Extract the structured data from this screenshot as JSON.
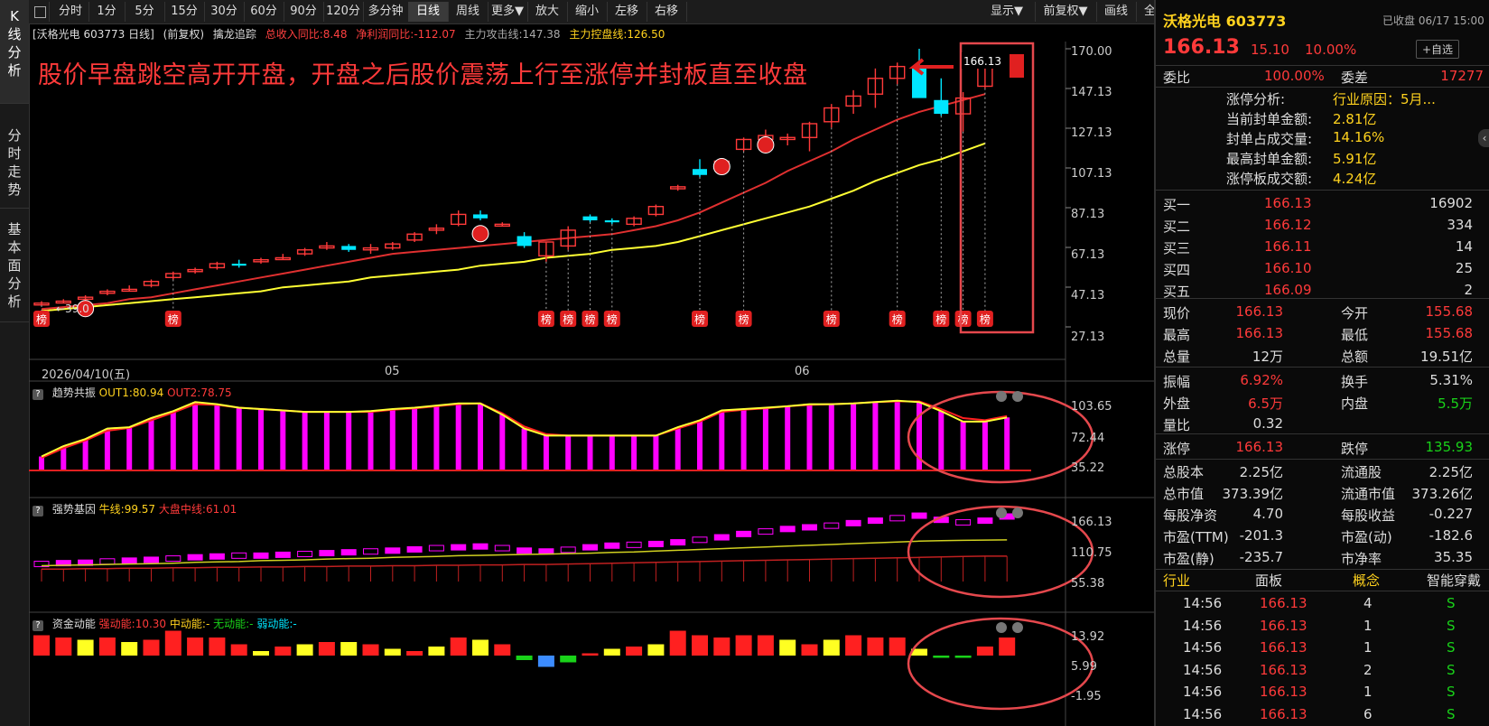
{
  "left_rail": [
    {
      "label": "K线分析"
    },
    {
      "label": "分时走势"
    },
    {
      "label": "基本面分析"
    }
  ],
  "toolbar": {
    "items": [
      "分时",
      "1分",
      "5分",
      "15分",
      "30分",
      "60分",
      "90分",
      "120分",
      "多分钟",
      "日线",
      "周线",
      "更多▼",
      "放大",
      "缩小",
      "左移",
      "右移"
    ],
    "active": "日线",
    "right_items": [
      "显示▼",
      "前复权▼",
      "画线",
      "全屏"
    ]
  },
  "chart_info": {
    "name": "[沃格光电 603773 日线]",
    "adj": "(前复权)",
    "indicator": "擒龙追踪",
    "rev": "总收入同比:8.48",
    "profit": "净利润同比:-112.07",
    "attack": "主力攻击线:147.38",
    "control": "主力控盘线:126.50"
  },
  "annotation": "股价早盘跳空高开开盘，开盘之后股价震荡上行至涨停并封板直至收盘",
  "price_axis": [
    "170.00",
    "147.13",
    "127.13",
    "107.13",
    "87.13",
    "67.13",
    "47.13",
    "27.13"
  ],
  "last_price_tag": "166.13",
  "low_tag": "39.0",
  "bang_label": "榜",
  "date_labels": {
    "start": "2026/04/10(五)",
    "m05": "05",
    "m06": "06"
  },
  "panel1": {
    "name": "趋势共振",
    "out1": "OUT1:80.94",
    "out2": "OUT2:78.75",
    "axis": [
      "103.65",
      "72.44",
      "35.22"
    ]
  },
  "panel2": {
    "name": "强势基因",
    "bull": "牛线:99.57",
    "market": "大盘中线:61.01",
    "axis": [
      "166.13",
      "110.75",
      "55.38"
    ]
  },
  "panel3": {
    "name": "资金动能",
    "strong": "强动能:10.30",
    "mid": "中动能:-",
    "none": "无动能:-",
    "weak": "弱动能:-",
    "axis": [
      "13.92",
      "5.99",
      "-1.95"
    ]
  },
  "colors": {
    "up": "#ff3a3a",
    "down": "#00e5ff",
    "ma_yellow": "#ffff33",
    "magenta": "#ff00ff",
    "annotation": "#ff3a3a",
    "highlight": "#e5484d"
  },
  "right_panel": {
    "title": "沃格光电 603773",
    "status": "已收盘 06/17 15:00",
    "price": "166.13",
    "change": "15.10",
    "pct": "10.00%",
    "add_btn": "+自选",
    "weibi_label": "委比",
    "weibi": "100.00%",
    "weicha_label": "委差",
    "weicha": "17277",
    "limit_info": [
      {
        "label": "涨停分析:",
        "value": "行业原因：5月..."
      },
      {
        "label": "当前封单金额:",
        "value": "2.81亿"
      },
      {
        "label": "封单占成交量:",
        "value": "14.16%"
      },
      {
        "label": "最高封单金额:",
        "value": "5.91亿"
      },
      {
        "label": "涨停板成交额:",
        "value": "4.24亿"
      }
    ],
    "bids": [
      {
        "label": "买一",
        "price": "166.13",
        "vol": "16902"
      },
      {
        "label": "买二",
        "price": "166.12",
        "vol": "334"
      },
      {
        "label": "买三",
        "price": "166.11",
        "vol": "14"
      },
      {
        "label": "买四",
        "price": "166.10",
        "vol": "25"
      },
      {
        "label": "买五",
        "price": "166.09",
        "vol": "2"
      }
    ],
    "quote": [
      {
        "l1": "现价",
        "v1": "166.13",
        "l2": "今开",
        "v2": "155.68"
      },
      {
        "l1": "最高",
        "v1": "166.13",
        "l2": "最低",
        "v2": "155.68"
      },
      {
        "l1": "总量",
        "v1": "12万",
        "l2": "总额",
        "v2": "19.51亿"
      }
    ],
    "stats": [
      {
        "l1": "振幅",
        "v1": "6.92%",
        "l2": "换手",
        "v2": "5.31%"
      },
      {
        "l1": "外盘",
        "v1": "6.5万",
        "l2": "内盘",
        "v2": "5.5万"
      },
      {
        "l1": "量比",
        "v1": "0.32",
        "l2": "",
        "v2": ""
      }
    ],
    "limits": {
      "up_label": "涨停",
      "up": "166.13",
      "down_label": "跌停",
      "down": "135.93"
    },
    "fundamentals": [
      {
        "l1": "总股本",
        "v1": "2.25亿",
        "l2": "流通股",
        "v2": "2.25亿"
      },
      {
        "l1": "总市值",
        "v1": "373.39亿",
        "l2": "流通市值",
        "v2": "373.26亿"
      },
      {
        "l1": "每股净资",
        "v1": "4.70",
        "l2": "每股收益",
        "v2": "-0.227"
      },
      {
        "l1": "市盈(TTM)",
        "v1": "-201.3",
        "l2": "市盈(动)",
        "v2": "-182.6"
      },
      {
        "l1": "市盈(静)",
        "v1": "-235.7",
        "l2": "市净率",
        "v2": "35.35"
      }
    ],
    "tabs": [
      "行业",
      "面板",
      "概念",
      "智能穿戴"
    ],
    "trades": [
      {
        "time": "14:56",
        "price": "166.13",
        "vol": "4",
        "side": "S"
      },
      {
        "time": "14:56",
        "price": "166.13",
        "vol": "1",
        "side": "S"
      },
      {
        "time": "14:56",
        "price": "166.13",
        "vol": "1",
        "side": "S"
      },
      {
        "time": "14:56",
        "price": "166.13",
        "vol": "2",
        "side": "S"
      },
      {
        "time": "14:56",
        "price": "166.13",
        "vol": "1",
        "side": "S"
      },
      {
        "time": "14:56",
        "price": "166.13",
        "vol": "6",
        "side": "S"
      }
    ]
  },
  "chart_data": [
    {
      "type": "candlestick",
      "title": "沃格光电 603773 日线",
      "ylim": [
        27.13,
        170.0
      ],
      "series": [
        {
          "name": "K线",
          "ohlc": [
            [
              41,
              42,
              40,
              41
            ],
            [
              42,
              43,
              41,
              42
            ],
            [
              43,
              45,
              42,
              44
            ],
            [
              46,
              48,
              45,
              47
            ],
            [
              48,
              50,
              47,
              48
            ],
            [
              50,
              53,
              49,
              52
            ],
            [
              54,
              57,
              53,
              56
            ],
            [
              57,
              59,
              56,
              58
            ],
            [
              59,
              62,
              58,
              61
            ],
            [
              61,
              63,
              59,
              60
            ],
            [
              62,
              64,
              61,
              63
            ],
            [
              64,
              66,
              63,
              64
            ],
            [
              66,
              69,
              65,
              68
            ],
            [
              69,
              72,
              68,
              70
            ],
            [
              70,
              71,
              67,
              68
            ],
            [
              68,
              71,
              66,
              69
            ],
            [
              69,
              72,
              68,
              71
            ],
            [
              73,
              77,
              72,
              76
            ],
            [
              78,
              81,
              76,
              79
            ],
            [
              81,
              88,
              80,
              86
            ],
            [
              86,
              88,
              83,
              84
            ],
            [
              81,
              82,
              80,
              81
            ],
            [
              75,
              77,
              69,
              70
            ],
            [
              65,
              72,
              62,
              72
            ],
            [
              70,
              80,
              68,
              78
            ],
            [
              85,
              86,
              82,
              83
            ],
            [
              83,
              84,
              81,
              82
            ],
            [
              81,
              85,
              80,
              84
            ],
            [
              86,
              91,
              85,
              90
            ],
            [
              99,
              101,
              98,
              100
            ],
            [
              109,
              114,
              105,
              106
            ],
            [
              109,
              114,
              108,
              113
            ],
            [
              119,
              125,
              118,
              124
            ],
            [
              124,
              129,
              120,
              126
            ],
            [
              124,
              127,
              121,
              125
            ],
            [
              125,
              133,
              118,
              132
            ],
            [
              133,
              142,
              130,
              140
            ],
            [
              141,
              149,
              137,
              146
            ],
            [
              147,
              160,
              140,
              155
            ],
            [
              155,
              163,
              152,
              161
            ],
            [
              160,
              170,
              154,
              145
            ],
            [
              144,
              155,
              136,
              137
            ],
            [
              137,
              148,
              128,
              145
            ],
            [
              151,
              166,
              150,
              166
            ]
          ]
        },
        {
          "name": "MA红",
          "values": [
            38,
            39,
            40,
            41,
            43,
            44,
            46,
            48,
            50,
            52,
            54,
            56,
            58,
            60,
            62,
            64,
            66,
            67,
            68,
            69,
            70,
            71,
            72,
            73,
            74,
            75,
            76,
            78,
            80,
            83,
            87,
            92,
            97,
            102,
            108,
            113,
            118,
            124,
            129,
            134,
            138,
            141,
            144,
            147
          ]
        },
        {
          "name": "MA黄",
          "values": [
            37,
            38,
            39,
            40,
            41,
            42,
            43,
            44,
            45,
            46,
            47,
            49,
            50,
            51,
            52,
            54,
            55,
            56,
            57,
            58,
            60,
            61,
            62,
            64,
            65,
            66,
            68,
            69,
            70,
            72,
            75,
            78,
            81,
            84,
            87,
            90,
            94,
            98,
            103,
            107,
            111,
            114,
            118,
            122
          ]
        }
      ]
    },
    {
      "type": "bar",
      "title": "趋势共振",
      "ylim": [
        0,
        110
      ],
      "series": [
        {
          "name": "bars",
          "values": [
            20,
            35,
            45,
            60,
            62,
            75,
            85,
            98,
            95,
            90,
            88,
            86,
            84,
            84,
            84,
            85,
            88,
            90,
            93,
            96,
            96,
            80,
            60,
            50,
            50,
            50,
            50,
            50,
            50,
            62,
            72,
            86,
            88,
            90,
            92,
            95,
            95,
            96,
            98,
            100,
            98,
            85,
            70,
            70,
            76
          ]
        },
        {
          "name": "OUT1",
          "values": [
            20,
            35,
            45,
            60,
            62,
            75,
            85,
            98,
            95,
            90,
            88,
            86,
            84,
            84,
            84,
            85,
            88,
            90,
            93,
            96,
            96,
            80,
            60,
            50,
            50,
            50,
            50,
            50,
            50,
            62,
            72,
            86,
            88,
            90,
            92,
            95,
            95,
            96,
            98,
            100,
            98,
            85,
            70,
            70,
            76
          ]
        },
        {
          "name": "OUT2",
          "values": [
            18,
            32,
            43,
            57,
            61,
            72,
            83,
            95,
            94,
            90,
            88,
            86,
            84,
            84,
            84,
            84,
            87,
            89,
            92,
            95,
            96,
            82,
            63,
            52,
            50,
            50,
            50,
            50,
            50,
            60,
            70,
            84,
            87,
            89,
            92,
            94,
            95,
            96,
            98,
            99,
            99,
            88,
            75,
            72,
            78
          ]
        }
      ]
    },
    {
      "type": "bar",
      "title": "强势基因",
      "ylim": [
        0,
        180
      ],
      "series": [
        {
          "name": "K",
          "values": [
            40,
            42,
            43,
            46,
            48,
            50,
            53,
            56,
            58,
            60,
            60,
            62,
            64,
            66,
            68,
            70,
            72,
            75,
            78,
            80,
            82,
            78,
            72,
            70,
            74,
            80,
            84,
            86,
            88,
            92,
            98,
            104,
            112,
            118,
            124,
            128,
            132,
            138,
            144,
            150,
            156,
            146,
            140,
            144,
            154
          ]
        },
        {
          "name": "牛线",
          "values": [
            38,
            39,
            40,
            41,
            42,
            43,
            44,
            46,
            47,
            48,
            50,
            51,
            52,
            54,
            55,
            56,
            58,
            59,
            60,
            62,
            63,
            64,
            65,
            66,
            67,
            68,
            70,
            71,
            73,
            75,
            77,
            79,
            81,
            83,
            85,
            87,
            89,
            91,
            93,
            95,
            97,
            98,
            99,
            99.57,
            100
          ]
        },
        {
          "name": "大盘中线",
          "values": [
            30,
            30,
            31,
            31,
            32,
            32,
            33,
            33,
            34,
            34,
            35,
            35,
            36,
            36,
            37,
            37,
            38,
            38,
            39,
            39,
            40,
            40,
            41,
            41,
            42,
            43,
            44,
            45,
            46,
            47,
            48,
            49,
            50,
            51,
            52,
            53,
            54,
            55,
            56,
            57,
            58,
            59,
            60,
            61,
            61.01
          ]
        }
      ]
    },
    {
      "type": "bar",
      "title": "资金动能",
      "ylim": [
        -5,
        16
      ],
      "series": [
        {
          "name": "动能",
          "values": [
            9,
            8,
            7,
            8,
            6,
            7,
            11,
            8,
            8,
            5,
            2,
            4,
            5,
            6,
            6,
            5,
            3,
            2,
            4,
            8,
            7,
            5,
            -2,
            -5,
            -3,
            1,
            3,
            4,
            5,
            11,
            9,
            8,
            9,
            9,
            7,
            5,
            7,
            9,
            8,
            8,
            3,
            -1,
            -1,
            4,
            8
          ]
        }
      ]
    }
  ]
}
